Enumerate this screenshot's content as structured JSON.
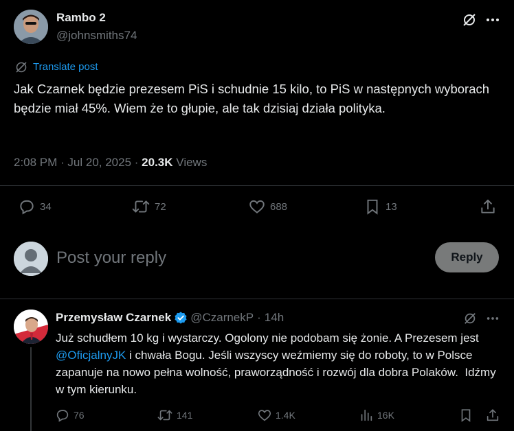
{
  "main_post": {
    "author_name": "Rambo 2",
    "author_handle": "@johnsmiths74",
    "translate_label": "Translate post",
    "text": "Jak Czarnek będzie prezesem PiS i schudnie 15 kilo, to PiS w następnych wyborach będzie miał 45%. Wiem że to głupie, ale tak dzisiaj działa polityka.",
    "meta": "2:08 PM · Jul 20, 2025 ·",
    "views_count": "20.3K",
    "views_label": "Views",
    "actions": {
      "replies": "34",
      "reposts": "72",
      "likes": "688",
      "bookmarks": "13"
    }
  },
  "reply_box": {
    "placeholder": "Post your reply",
    "button_label": "Reply"
  },
  "reply_post": {
    "author_name": "Przemysław Czarnek",
    "author_handle": "@CzarnekP",
    "dot": "·",
    "time": "14h",
    "text_before": "Już schudłem 10 kg i wystarczy. Ogolony nie podobam się żonie. A Prezesem jest ",
    "mention": "@OficjalnyJK",
    "text_after": " i chwała Bogu. Jeśli wszyscy weźmiemy się do roboty, to w Polsce zapanuje na nowo pełna wolność, praworządność i rozwój dla dobra Polaków.  Idźmy w tym kierunku.",
    "actions": {
      "replies": "76",
      "reposts": "141",
      "likes": "1.4K",
      "views": "16K"
    }
  },
  "colors": {
    "background": "#000000",
    "text": "#e7e9ea",
    "muted": "#71767b",
    "accent": "#1d9bf0",
    "verified": "#1d9bf0",
    "reply_button": "#787a7a"
  }
}
